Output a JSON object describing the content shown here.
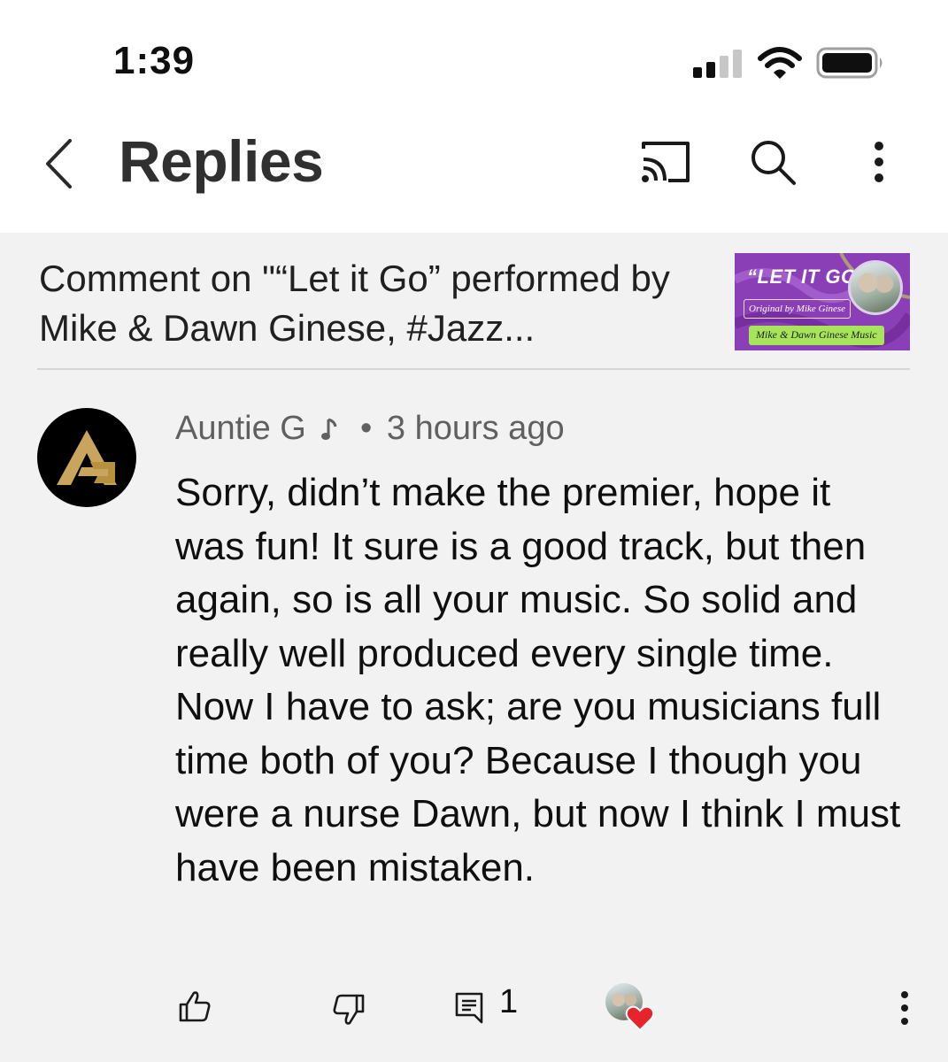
{
  "status_bar": {
    "time": "1:39"
  },
  "app_bar": {
    "title": "Replies",
    "icons": [
      "back-icon",
      "cast-icon",
      "search-icon",
      "more-vert-icon"
    ]
  },
  "context": {
    "text": "Comment on \"“Let it Go” performed by Mike & Dawn Ginese, #Jazz...",
    "thumbnail": {
      "title": "“LET IT GO”",
      "subtitle": "Original by Mike Ginese",
      "footer": "Mike & Dawn Ginese Music",
      "background_color": "#8a3fb6"
    }
  },
  "comment": {
    "author": "Auntie G",
    "author_badge_icon": "music-note-icon",
    "separator": "•",
    "time": "3 hours ago",
    "body": "Sorry, didn’t make the premier, hope it was fun! It sure is a good track, but then again, so is all your music. So solid and really well produced every single time. Now I have to ask; are you musicians full time both of you? Because I though you were a nurse Dawn, but now I think I must have been mistaken.",
    "reply_count": "1",
    "action_icons": [
      "like-icon",
      "dislike-icon",
      "reply-icon",
      "creator-heart-icon",
      "more-vert-icon"
    ]
  },
  "colors": {
    "app_bar_bg": "#ffffff",
    "content_bg": "#f2f2f2",
    "meta_text": "#606060",
    "heart": "#e5252b",
    "avatar_gold": "#c9a45c"
  }
}
